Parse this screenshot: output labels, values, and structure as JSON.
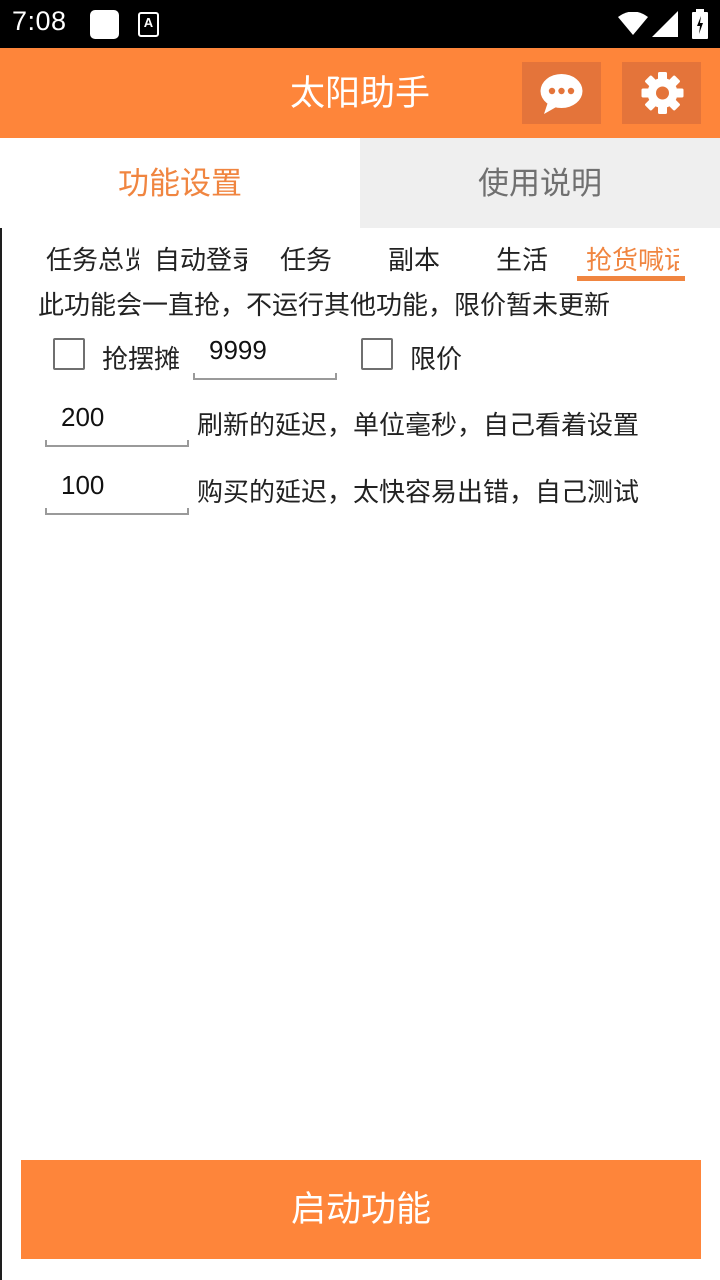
{
  "status_bar": {
    "time": "7:08",
    "accessibility_glyph": "A",
    "icons": [
      "notification-square-icon",
      "accessibility-icon",
      "wifi-icon",
      "signal-icon",
      "battery-icon"
    ]
  },
  "app_bar": {
    "title": "太阳助手",
    "chat_icon": "chat-bubble-icon",
    "settings_icon": "gear-icon",
    "color": "#fe853a"
  },
  "main_tabs": [
    {
      "label": "功能设置",
      "active": true
    },
    {
      "label": "使用说明",
      "active": false
    }
  ],
  "sub_tabs": [
    {
      "label": "任务总览"
    },
    {
      "label": "自动登录"
    },
    {
      "label": "任务"
    },
    {
      "label": "副本"
    },
    {
      "label": "生活"
    },
    {
      "label": "抢货喊话",
      "active": true
    }
  ],
  "notice": "此功能会一直抢，不运行其他功能，限价暂未更新",
  "grab_stall": {
    "checkbox_label": "抢摆摊",
    "checked": false,
    "amount": "9999"
  },
  "limit_price": {
    "checkbox_label": "限价",
    "checked": false
  },
  "refresh_delay": {
    "value": "200",
    "description": "刷新的延迟，单位毫秒，自己看着设置"
  },
  "buy_delay": {
    "value": "100",
    "description": "购买的延迟，太快容易出错，自己测试"
  },
  "start_button": {
    "label": "启动功能"
  },
  "colors": {
    "accent": "#fe853a",
    "tab_active_text": "#f08540",
    "tab_inactive_bg": "#efefef"
  }
}
